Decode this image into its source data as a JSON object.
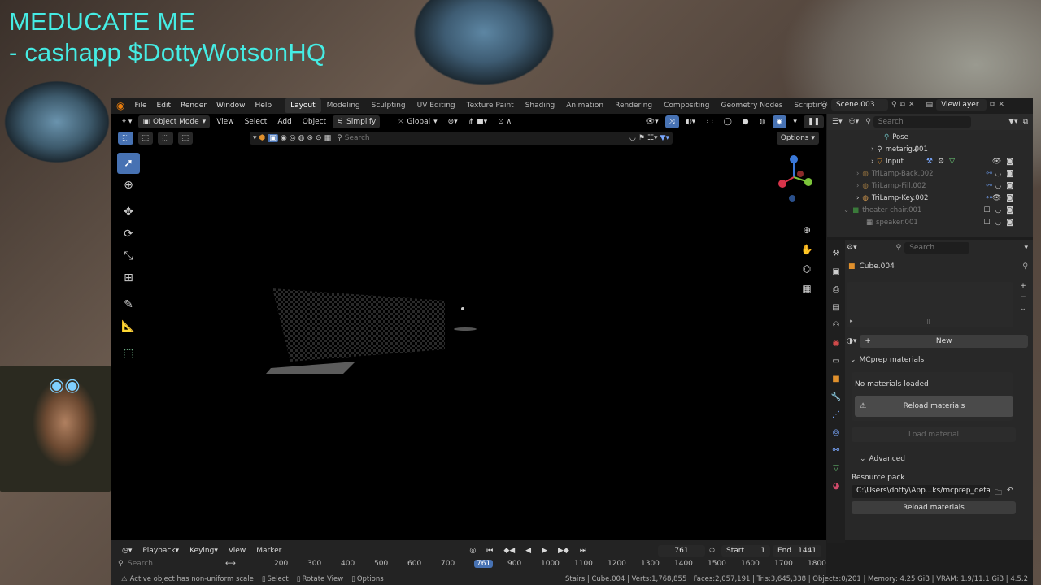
{
  "overlay": {
    "line1": "MEDUCATE ME",
    "line2": "- cashapp $DottyWotsonHQ"
  },
  "topbar": {
    "menus": [
      "File",
      "Edit",
      "Render",
      "Window",
      "Help"
    ],
    "workspaces": [
      "Layout",
      "Modeling",
      "Sculpting",
      "UV Editing",
      "Texture Paint",
      "Shading",
      "Animation",
      "Rendering",
      "Compositing",
      "Geometry Nodes",
      "Scripting"
    ],
    "active_workspace": "Layout",
    "add_tab": "+",
    "scene": "Scene.003",
    "view_layer": "ViewLayer"
  },
  "viewport_header": {
    "mode": "Object Mode",
    "menus": [
      "View",
      "Select",
      "Add",
      "Object"
    ],
    "simplify": "Simplify",
    "orientation": "Global",
    "search_placeholder": "Search",
    "options": "Options"
  },
  "timeline": {
    "menus": [
      "Playback",
      "Keying",
      "View",
      "Marker"
    ],
    "current_frame": "761",
    "start_label": "Start",
    "start": "1",
    "end_label": "End",
    "end": "1441",
    "search_placeholder": "Search",
    "ticks": [
      "200",
      "300",
      "400",
      "500",
      "600",
      "700",
      "761",
      "900",
      "1000",
      "1100",
      "1200",
      "1300",
      "1400",
      "1500",
      "1600",
      "1700",
      "1800"
    ]
  },
  "statusbar": {
    "warning": "Active object has non-uniform scale",
    "select": "Select",
    "rotate": "Rotate View",
    "options": "Options",
    "stats": "Stairs | Cube.004 | Verts:1,768,855 | Faces:2,057,191 | Tris:3,645,338 | Objects:0/201 | Memory: 4.25 GiB | VRAM: 1.9/11.1 GiB | 4.5.2"
  },
  "outliner": {
    "search_placeholder": "Search",
    "rows": [
      {
        "label": "Pose",
        "dim": false,
        "indent": 3
      },
      {
        "label": "metarig.001",
        "dim": false,
        "indent": 3
      },
      {
        "label": "Input",
        "dim": false,
        "indent": 3
      },
      {
        "label": "TriLamp-Back.002",
        "dim": true,
        "indent": 2
      },
      {
        "label": "TriLamp-Fill.002",
        "dim": true,
        "indent": 2
      },
      {
        "label": "TriLamp-Key.002",
        "dim": false,
        "indent": 2
      },
      {
        "label": "theater chair.001",
        "dim": true,
        "indent": 1
      },
      {
        "label": "speaker.001",
        "dim": true,
        "indent": 2
      }
    ]
  },
  "properties": {
    "search_placeholder": "Search",
    "object_name": "Cube.004",
    "new_button": "New",
    "panel_title": "MCprep materials",
    "no_materials": "No materials loaded",
    "reload_materials": "Reload materials",
    "load_material": "Load material",
    "advanced": "Advanced",
    "resource_pack_label": "Resource pack",
    "resource_pack_path": "C:\\Users\\dotty\\App...ks/mcprep_default/",
    "reload_materials_2": "Reload materials"
  },
  "colors": {
    "accent": "#4772b3",
    "overlay_text": "#45ece4",
    "blender_orange": "#e87d0d"
  }
}
